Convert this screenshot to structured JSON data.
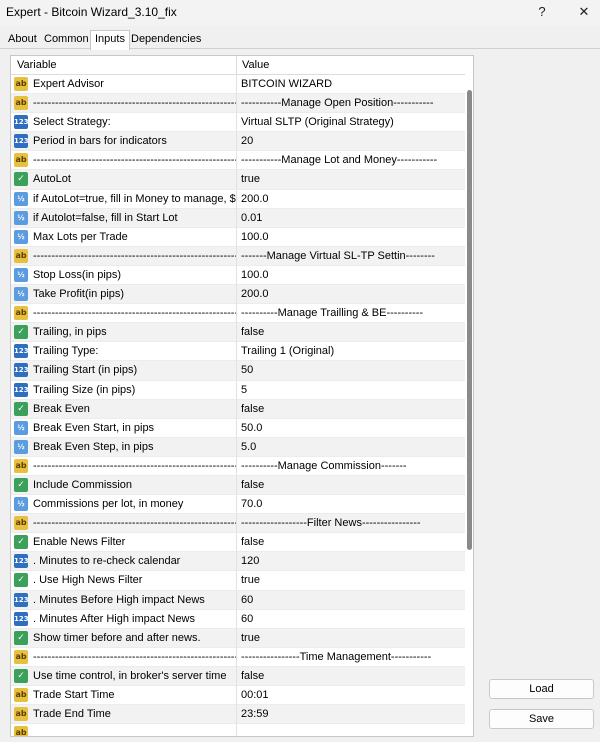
{
  "window": {
    "title": "Expert - Bitcoin Wizard_3.10_fix",
    "help_glyph": "?",
    "close_glyph": "✕"
  },
  "tabs": [
    "About",
    "Common",
    "Inputs",
    "Dependencies"
  ],
  "active_tab": "Inputs",
  "grid": {
    "col_variable": "Variable",
    "col_value": "Value",
    "rows": [
      {
        "icon": "ab",
        "variable": "Expert Advisor",
        "value": "BITCOIN WIZARD"
      },
      {
        "icon": "ab",
        "variable": "------------------------------------------------------------------",
        "value": "-----------Manage Open Position-----------"
      },
      {
        "icon": "123",
        "variable": "Select Strategy:",
        "value": "Virtual SLTP (Original Strategy)"
      },
      {
        "icon": "123",
        "variable": "Period in bars for indicators",
        "value": "20"
      },
      {
        "icon": "ab",
        "variable": "------------------------------------------------------------------",
        "value": "-----------Manage Lot and Money-----------"
      },
      {
        "icon": "bool",
        "variable": "AutoLot",
        "value": "true"
      },
      {
        "icon": "v2",
        "variable": "if AutoLot=true, fill in Money to manage, $",
        "value": "200.0"
      },
      {
        "icon": "v2",
        "variable": "if Autolot=false, fill in Start Lot",
        "value": "0.01"
      },
      {
        "icon": "v2",
        "variable": "Max Lots per Trade",
        "value": "100.0"
      },
      {
        "icon": "ab",
        "variable": "------------------------------------------------------------------",
        "value": "-------Manage Virtual SL-TP Settin--------"
      },
      {
        "icon": "v2",
        "variable": "Stop Loss(in pips)",
        "value": "100.0"
      },
      {
        "icon": "v2",
        "variable": "Take Profit(in pips)",
        "value": "200.0"
      },
      {
        "icon": "ab",
        "variable": "------------------------------------------------------------------",
        "value": "----------Manage Trailling & BE----------"
      },
      {
        "icon": "bool",
        "variable": "Trailing, in pips",
        "value": "false"
      },
      {
        "icon": "123",
        "variable": "Trailing Type:",
        "value": "Trailing 1 (Original)"
      },
      {
        "icon": "123",
        "variable": "Trailing Start (in pips)",
        "value": "50"
      },
      {
        "icon": "123",
        "variable": "Trailing Size (in pips)",
        "value": "5"
      },
      {
        "icon": "bool",
        "variable": "Break Even",
        "value": "false"
      },
      {
        "icon": "v2",
        "variable": "Break Even Start, in pips",
        "value": "50.0"
      },
      {
        "icon": "v2",
        "variable": "Break Even Step, in pips",
        "value": "5.0"
      },
      {
        "icon": "ab",
        "variable": "------------------------------------------------------------------",
        "value": "----------Manage Commission-------"
      },
      {
        "icon": "bool",
        "variable": "Include Commission",
        "value": "false"
      },
      {
        "icon": "v2",
        "variable": "Commissions per lot, in money",
        "value": "70.0"
      },
      {
        "icon": "ab",
        "variable": "------------------------------------------------------------------",
        "value": "------------------Filter News----------------"
      },
      {
        "icon": "bool",
        "variable": "Enable News Filter",
        "value": "false"
      },
      {
        "icon": "123",
        "variable": ". Minutes to re-check calendar",
        "value": "120"
      },
      {
        "icon": "bool",
        "variable": ". Use High News Filter",
        "value": "true"
      },
      {
        "icon": "123",
        "variable": ". Minutes Before High impact News",
        "value": "60"
      },
      {
        "icon": "123",
        "variable": ". Minutes After High impact News",
        "value": "60"
      },
      {
        "icon": "bool",
        "variable": "Show timer before and after news.",
        "value": "true"
      },
      {
        "icon": "ab",
        "variable": "------------------------------------------------------------------",
        "value": "----------------Time Management-----------"
      },
      {
        "icon": "bool",
        "variable": "Use time control, in broker's server time",
        "value": "false"
      },
      {
        "icon": "ab",
        "variable": "Trade Start Time",
        "value": "00:01"
      },
      {
        "icon": "ab",
        "variable": "Trade End Time",
        "value": "23:59"
      },
      {
        "icon": "ab",
        "variable": "",
        "value": ""
      }
    ]
  },
  "icon_glyphs": {
    "ab": "ab",
    "123": "123",
    "bool": "✓",
    "v2": "½"
  },
  "buttons": {
    "load": "Load",
    "save": "Save"
  }
}
